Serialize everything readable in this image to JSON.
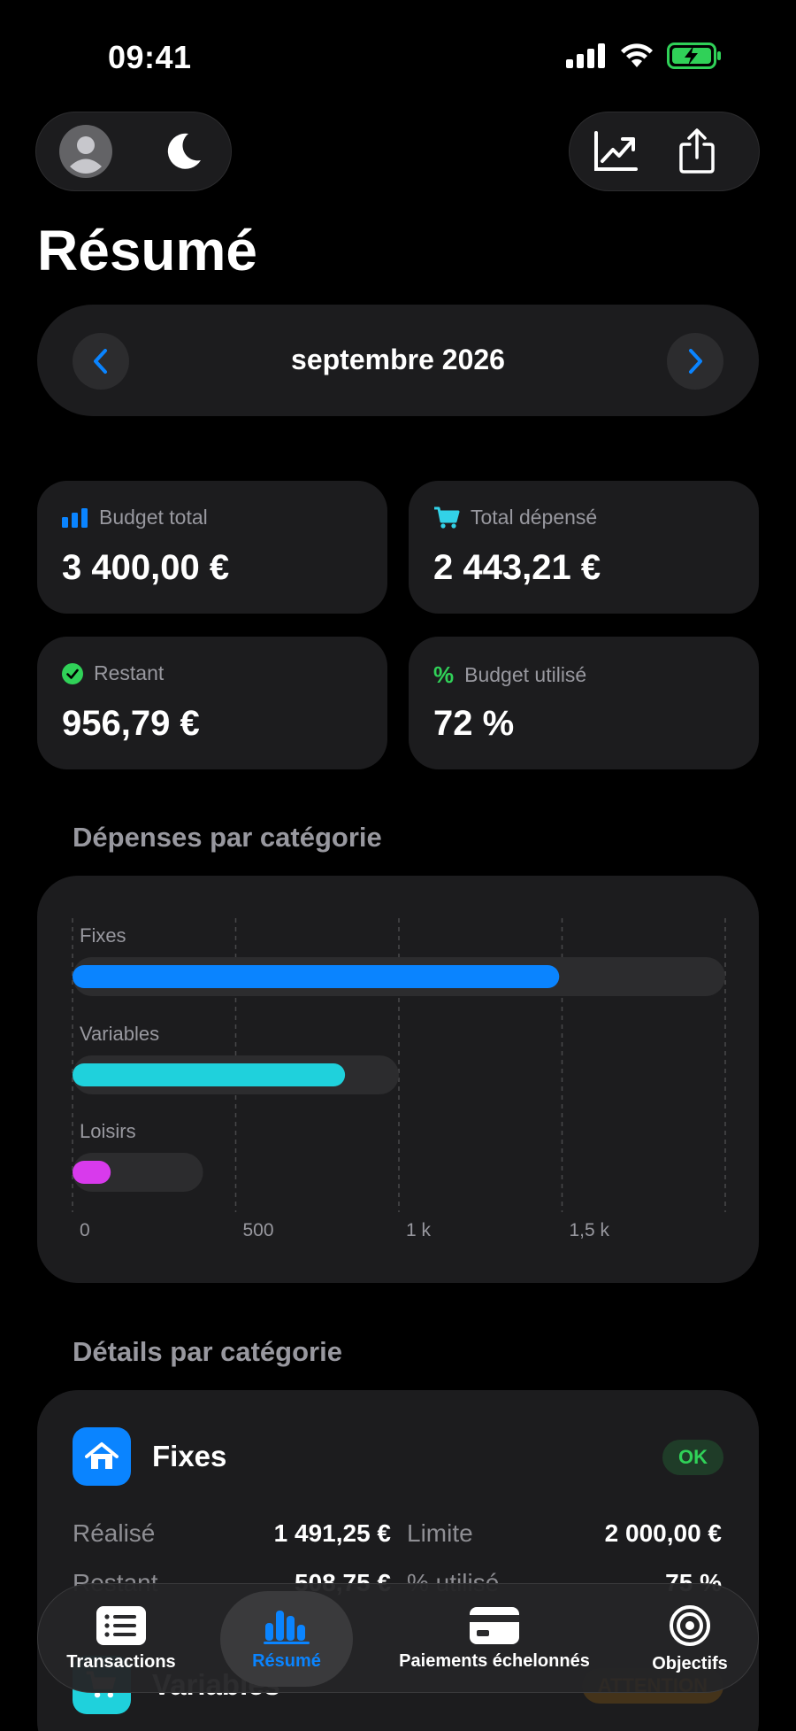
{
  "status": {
    "time": "09:41"
  },
  "page": {
    "title": "Résumé"
  },
  "month": {
    "label": "septembre 2026"
  },
  "stats": [
    {
      "label": "Budget total",
      "value": "3 400,00 €",
      "icon": "bar-chart-icon",
      "icon_color": "#0a84ff"
    },
    {
      "label": "Total dépensé",
      "value": "2 443,21 €",
      "icon": "cart-icon",
      "icon_color": "#32d2e8"
    },
    {
      "label": "Restant",
      "value": "956,79 €",
      "icon": "checkmark-circle-icon",
      "icon_color": "#30d158"
    },
    {
      "label": "Budget utilisé",
      "value": "72 %",
      "icon": "percent-icon",
      "icon_color": "#30d158"
    }
  ],
  "sections": {
    "chart_title": "Dépenses par catégorie",
    "details_title": "Détails par catégorie"
  },
  "chart_data": {
    "type": "bar",
    "orientation": "horizontal",
    "categories": [
      "Fixes",
      "Variables",
      "Loisirs"
    ],
    "series": [
      {
        "values": [
          1491.25,
          835,
          117
        ]
      }
    ],
    "limits": [
      2000,
      1000,
      400
    ],
    "colors": [
      "#0a84ff",
      "#1fd1dc",
      "#d83aec"
    ],
    "xlim": [
      0,
      2000
    ],
    "xticks": [
      0,
      500,
      1000,
      1500
    ],
    "xtick_labels": [
      "0",
      "500",
      "1 k",
      "1,5 k"
    ],
    "grid": true
  },
  "details": [
    {
      "name": "Fixes",
      "icon": "house-icon",
      "icon_color": "#0a84ff",
      "badge": "OK",
      "badge_color": "#30d158",
      "realise_label": "Réalisé",
      "realise_value": "1 491,25 €",
      "limite_label": "Limite",
      "limite_value": "2 000,00 €",
      "restant_label": "Restant",
      "restant_value": "508,75 €",
      "pct_label": "% utilisé",
      "pct_value": "75 %"
    },
    {
      "name": "Variables",
      "icon": "cart-icon",
      "icon_color": "#1fd1dc",
      "badge": "ATTENTION",
      "badge_color": "#ff9f0a"
    }
  ],
  "tabs": [
    {
      "label": "Transactions",
      "icon": "list-icon",
      "active": false
    },
    {
      "label": "Résumé",
      "icon": "bar-chart-icon",
      "active": true
    },
    {
      "label": "Paiements échelonnés",
      "icon": "credit-card-icon",
      "active": false
    },
    {
      "label": "Objectifs",
      "icon": "target-icon",
      "active": false
    }
  ]
}
